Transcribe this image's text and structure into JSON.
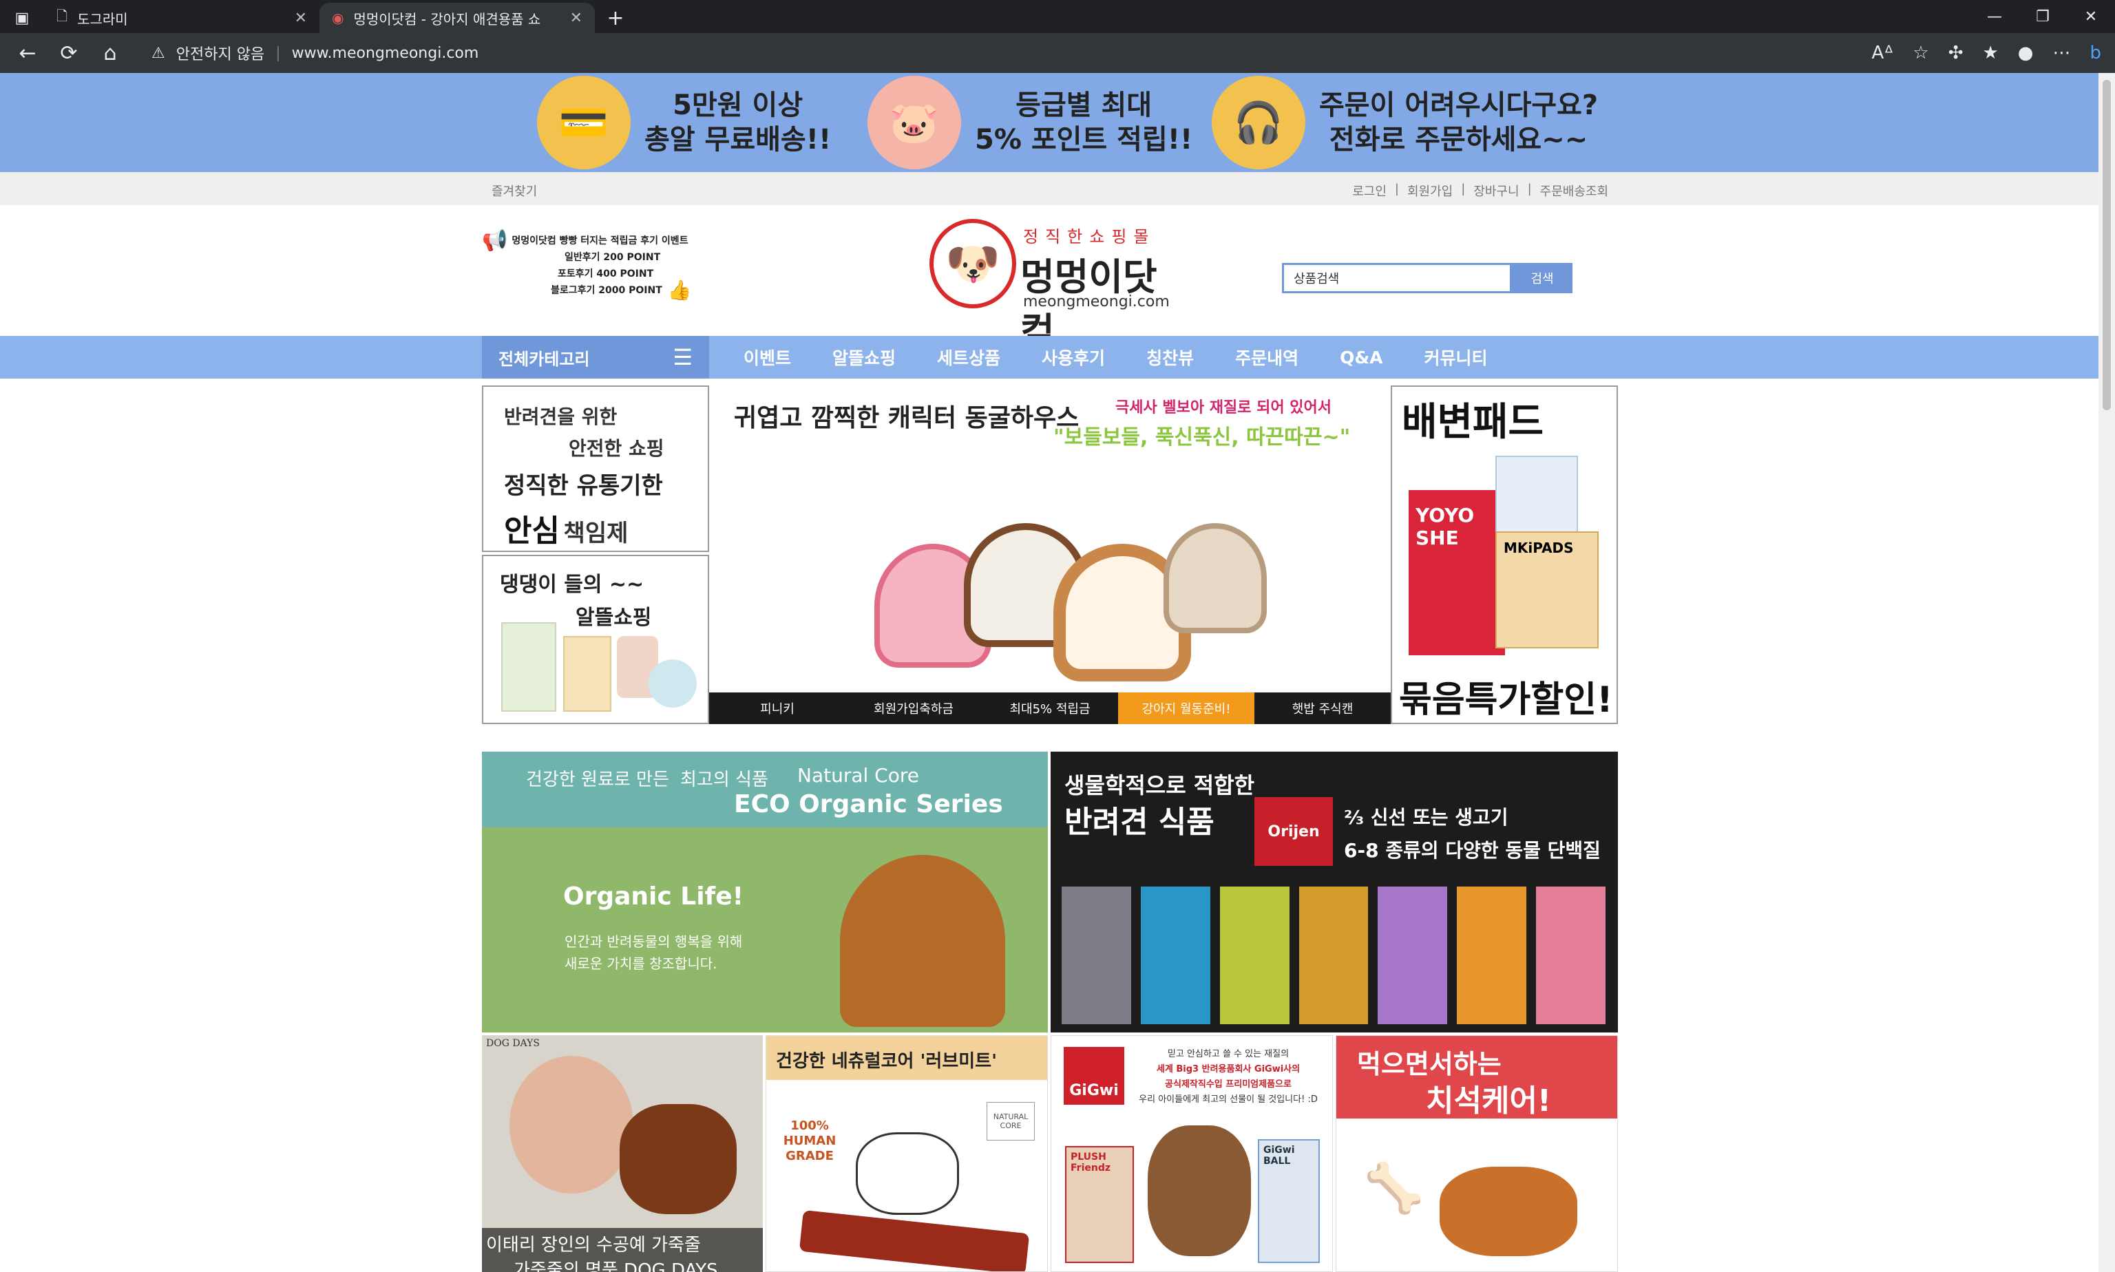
{
  "browser": {
    "tabs": [
      {
        "title": "도그라미",
        "active": false
      },
      {
        "title": "멍멍이닷컴 - 강아지 애견용품 쇼",
        "active": true
      }
    ],
    "security_label": "안전하지 않음",
    "url": "www.meongmeongi.com"
  },
  "promo_banner": {
    "items": [
      {
        "line1": "5만원 이상",
        "line2": "총알 무료배송!!",
        "icon": "card-icon"
      },
      {
        "line1": "등급별 최대",
        "line2": "5% 포인트 적립!!",
        "icon": "piggy-bank-icon"
      },
      {
        "line1": "주문이 어려우시다구요?",
        "line2": "전화로 주문하세요~~",
        "icon": "headset-icon"
      }
    ]
  },
  "util_bar": {
    "favorites": "즐겨찾기",
    "links": [
      "로그인",
      "회원가입",
      "장바구니",
      "주문배송조회"
    ]
  },
  "header": {
    "event_title": "멍멍이닷컴 빵빵 터지는 적립금 후기 이벤트",
    "event_lines": [
      "일반후기 200 POINT",
      "포토후기 400 POINT",
      "블로그후기 2000 POINT"
    ],
    "logo_slogan": "정직한쇼핑몰",
    "logo_name": "멍멍이닷컴",
    "logo_domain": "meongmeongi.com",
    "search_placeholder": "상품검색",
    "search_button": "검색"
  },
  "gnb": {
    "category_label": "전체카테고리",
    "menu": [
      "이벤트",
      "알뜰쇼핑",
      "세트상품",
      "사용후기",
      "칭찬뷰",
      "주문내역",
      "Q&A",
      "커뮤니티"
    ]
  },
  "left_banners": {
    "safe": {
      "line1": "반려견을 위한",
      "line2": "안전한 쇼핑",
      "line3": "정직한 유통기한",
      "line4a": "안심",
      "line4b": "책임제"
    },
    "thrift": {
      "line1": "댕댕이 들의 ~~",
      "line2": "알뜰쇼핑 ~~"
    }
  },
  "main_slider": {
    "headline": "귀엽고 깜찍한 캐릭터 동굴하우스",
    "sub1": "극세사 벨보아 재질로 되어 있어서",
    "sub2": "\"보들보들, 푹신푹신, 따끈따끈~\"",
    "tabs": [
      "피니키",
      "회원가입축하금",
      "최대5% 적립금",
      "강아지 월동준비!",
      "햇밥 주식캔"
    ],
    "active_tab": 3
  },
  "right_banner": {
    "title": "배변패드",
    "footer": "묶음특가할인!",
    "brand1": "YOYO SHE",
    "brand2": "MKiPADS"
  },
  "cards": {
    "eco": {
      "line1": "건강한 원료로 만든",
      "line2": "최고의 식품",
      "brand": "Natural Core",
      "series": "ECO Organic Series",
      "slogan": "Organic Life!",
      "desc1": "인간과 반려동물의 행복을 위해",
      "desc2": "새로운 가치를 창조합니다."
    },
    "orijen": {
      "title1": "생물학적으로 적합한",
      "title2": "반려견 식품",
      "brand": "Orijen",
      "point1": "⅔ 신선 또는 생고기",
      "point2": "6-8 종류의 다양한 동물 단백질"
    },
    "dogdays": {
      "tag": "DOG DAYS",
      "caption1": "이태리 장인의 수공예 가죽줄",
      "caption2": "가죽줄의 명품 DOG DAYS"
    },
    "lovemeat": {
      "title": "건강한 네츄럴코어 '러브미트'",
      "badge1": "100%",
      "badge2": "HUMAN",
      "badge3": "GRADE",
      "pack": "NATURAL CORE"
    },
    "gigwi": {
      "brand": "GiGwi",
      "line1": "믿고 안심하고 쓸 수 있는 재질의",
      "line2": "세계 Big3 반려용품회사 GiGwi사의",
      "line3": "공식제작직수입 프리미엄제품으로",
      "line4": "우리 아이들에게 최고의 선물이 될 것입니다! :D",
      "toy1": "PLUSH Friendz",
      "toy2": "GiGwi BALL"
    },
    "dental": {
      "title1": "먹으면서하는",
      "title2": "치석케어!"
    }
  },
  "colors": {
    "banner_blue": "#82a9e6",
    "nav_blue": "#8db3ec",
    "accent_orange": "#f39a1c",
    "teal": "#6eb3ac"
  }
}
